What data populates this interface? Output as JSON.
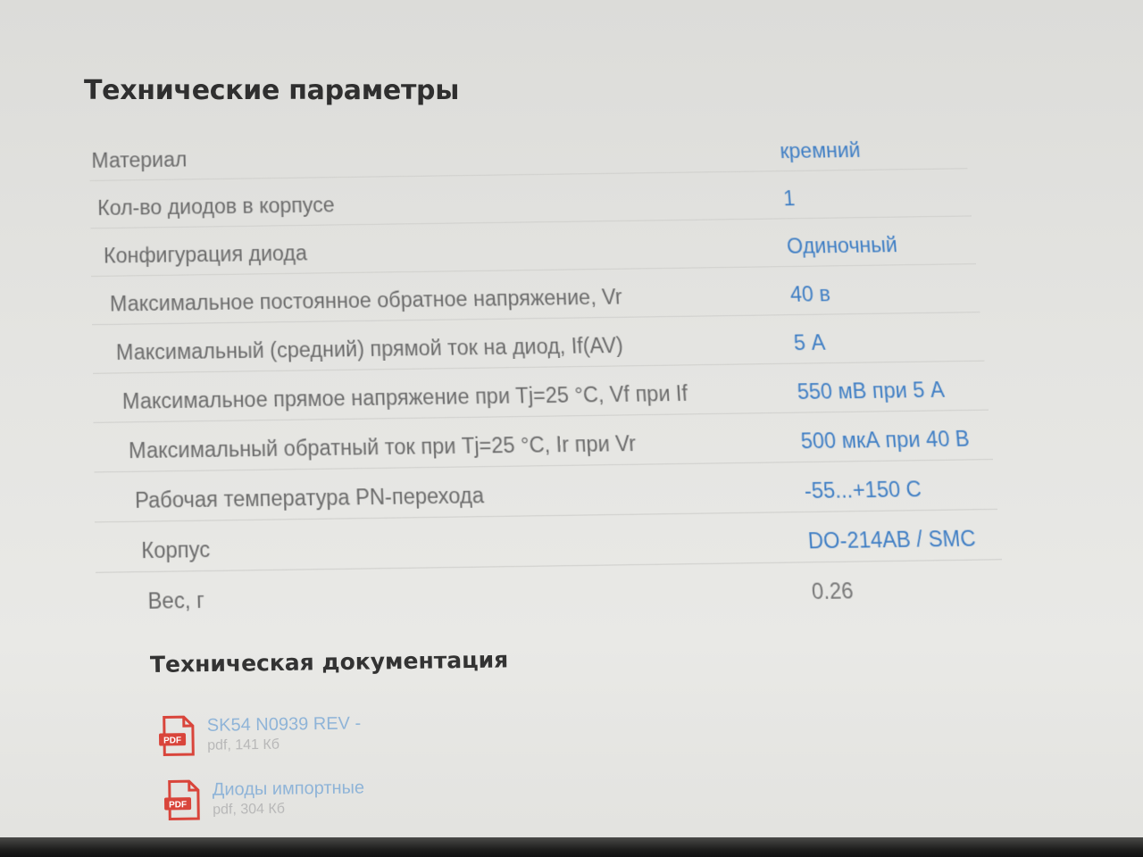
{
  "section_title": "Технические параметры",
  "specs": [
    {
      "label": "Материал",
      "value": "кремний",
      "link": true
    },
    {
      "label": "Кол-во диодов в корпусе",
      "value": "1",
      "link": true
    },
    {
      "label": "Конфигурация диода",
      "value": "Одиночный",
      "link": true
    },
    {
      "label": "Максимальное постоянное обратное напряжение, Vr",
      "value": "40 в",
      "link": true
    },
    {
      "label": "Максимальный (средний) прямой ток на диод, If(AV)",
      "value": "5 А",
      "link": true
    },
    {
      "label": "Максимальное прямое напряжение при Tj=25 °C, Vf при If",
      "value": "550 мВ при 5 А",
      "link": true
    },
    {
      "label": "Максимальный обратный ток при Tj=25 °C, Ir при Vr",
      "value": "500 мкА при 40 В",
      "link": true
    },
    {
      "label": "Рабочая температура PN-перехода",
      "value": "-55...+150 С",
      "link": true
    },
    {
      "label": "Корпус",
      "value": "DO-214AB / SMC",
      "link": true
    },
    {
      "label": "Вес, г",
      "value": "0.26",
      "link": false
    }
  ],
  "docs_title": "Техническая документация",
  "documents": [
    {
      "name": "SK54 N0939 REV -",
      "meta": "pdf, 141 Кб",
      "icon": "pdf-icon",
      "icon_label": "PDF"
    },
    {
      "name": "Диоды импортные",
      "meta": "pdf, 304 Кб",
      "icon": "pdf-icon",
      "icon_label": "PDF"
    }
  ],
  "colors": {
    "link": "#3f7ec4",
    "label": "#6b6b6b",
    "pdf_red": "#d9453b"
  }
}
